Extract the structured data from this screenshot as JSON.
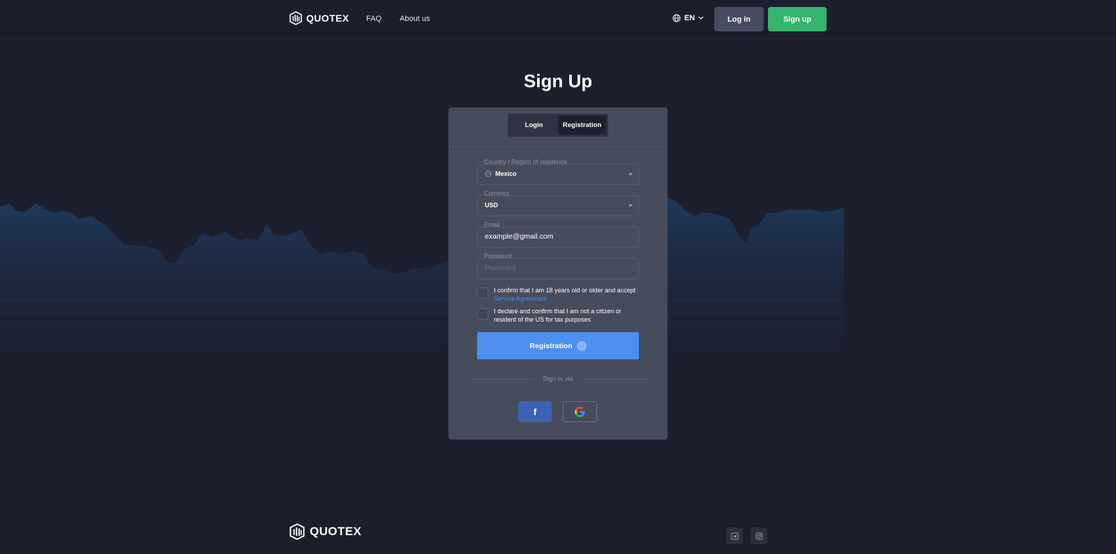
{
  "header": {
    "brand": "QUOTEX",
    "nav": {
      "faq": "FAQ",
      "about": "About us"
    },
    "language": "EN",
    "login_label": "Log in",
    "signup_label": "Sign up"
  },
  "page": {
    "title": "Sign Up"
  },
  "form": {
    "tabs": {
      "login": "Login",
      "registration": "Registration"
    },
    "country": {
      "label": "Country / Region of residence",
      "value": "Mexico"
    },
    "currency": {
      "label": "Currency",
      "value": "USD"
    },
    "email": {
      "label": "Email",
      "value": "example@gmail.com"
    },
    "password": {
      "label": "Password",
      "placeholder": "Password"
    },
    "confirm_age": {
      "text": "I confirm that I am 18 years old or older and accept",
      "link": "Service Agreement"
    },
    "confirm_us": {
      "text": "I declare and confirm that I am not a citizen or resident of the US for tax purposes"
    },
    "submit_label": "Registration",
    "signin_via": "Sign in via",
    "facebook_label": "f"
  },
  "footer": {
    "brand": "QUOTEX"
  },
  "colors": {
    "background": "#1c1f2d",
    "card": "#474c5d",
    "primary": "#4d8fee",
    "signup_green": "#36b36e",
    "facebook": "#3c63b2",
    "link": "#3f8fe6"
  },
  "icons": {
    "logo": "quotex-logo-icon",
    "language": "globe-icon",
    "dropdown": "chevron-down-icon",
    "submit_arrow": "arrow-right-circle-icon",
    "facebook": "facebook-icon",
    "google": "google-icon",
    "social_1": "telegram-icon",
    "social_2": "instagram-icon"
  }
}
